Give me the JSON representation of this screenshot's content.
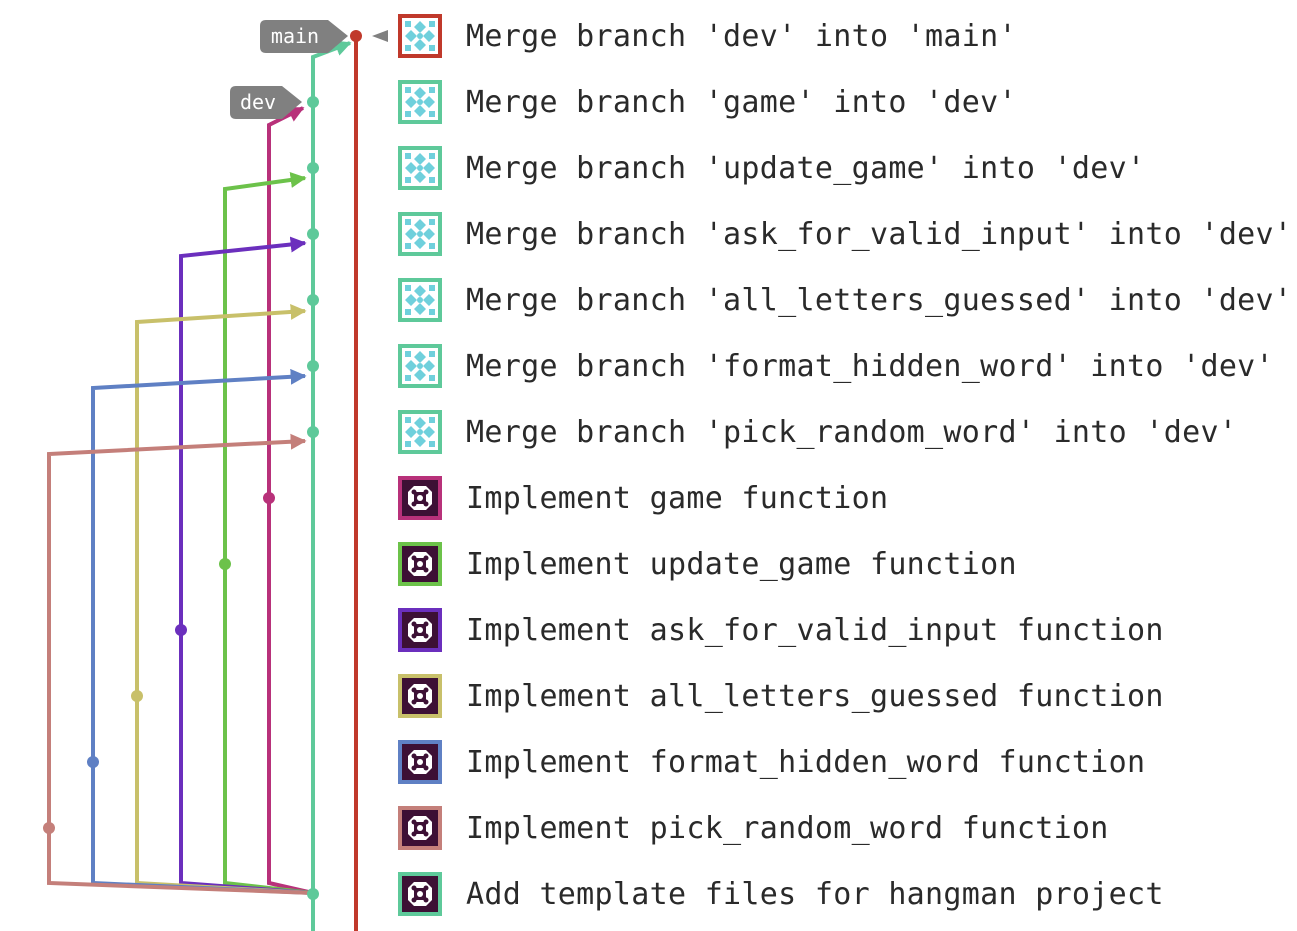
{
  "colors": {
    "main": "#c0392b",
    "dev": "#5ec99a",
    "game": "#b8317a",
    "update_game": "#6cc24a",
    "ask_for_valid_input": "#6b2fbd",
    "all_letters_guessed": "#c8c06a",
    "format_hidden_word": "#5f80c4",
    "pick_random_word": "#c47f7a",
    "label_bg": "#808080",
    "text": "#2a2a2a"
  },
  "refs": [
    {
      "name": "main",
      "branch": "main"
    },
    {
      "name": "dev",
      "branch": "dev"
    }
  ],
  "commits": [
    {
      "message": "Merge branch 'dev' into 'main'",
      "branch": "main",
      "avatar": "identicon-light"
    },
    {
      "message": "Merge branch 'game' into 'dev'",
      "branch": "dev",
      "avatar": "identicon-light"
    },
    {
      "message": "Merge branch 'update_game' into 'dev'",
      "branch": "dev",
      "avatar": "identicon-light"
    },
    {
      "message": "Merge branch 'ask_for_valid_input' into 'dev'",
      "branch": "dev",
      "avatar": "identicon-light"
    },
    {
      "message": "Merge branch 'all_letters_guessed' into 'dev'",
      "branch": "dev",
      "avatar": "identicon-light"
    },
    {
      "message": "Merge branch 'format_hidden_word' into 'dev'",
      "branch": "dev",
      "avatar": "identicon-light"
    },
    {
      "message": "Merge branch 'pick_random_word' into 'dev'",
      "branch": "dev",
      "avatar": "identicon-light"
    },
    {
      "message": "Implement game function",
      "branch": "game",
      "avatar": "identicon-dark"
    },
    {
      "message": "Implement update_game function",
      "branch": "update_game",
      "avatar": "identicon-dark"
    },
    {
      "message": "Implement ask_for_valid_input function",
      "branch": "ask_for_valid_input",
      "avatar": "identicon-dark"
    },
    {
      "message": "Implement all_letters_guessed function",
      "branch": "all_letters_guessed",
      "avatar": "identicon-dark"
    },
    {
      "message": "Implement format_hidden_word function",
      "branch": "format_hidden_word",
      "avatar": "identicon-dark"
    },
    {
      "message": "Implement pick_random_word function",
      "branch": "pick_random_word",
      "avatar": "identicon-dark"
    },
    {
      "message": "Add template files for hangman project",
      "branch": "dev",
      "avatar": "identicon-dark"
    }
  ]
}
